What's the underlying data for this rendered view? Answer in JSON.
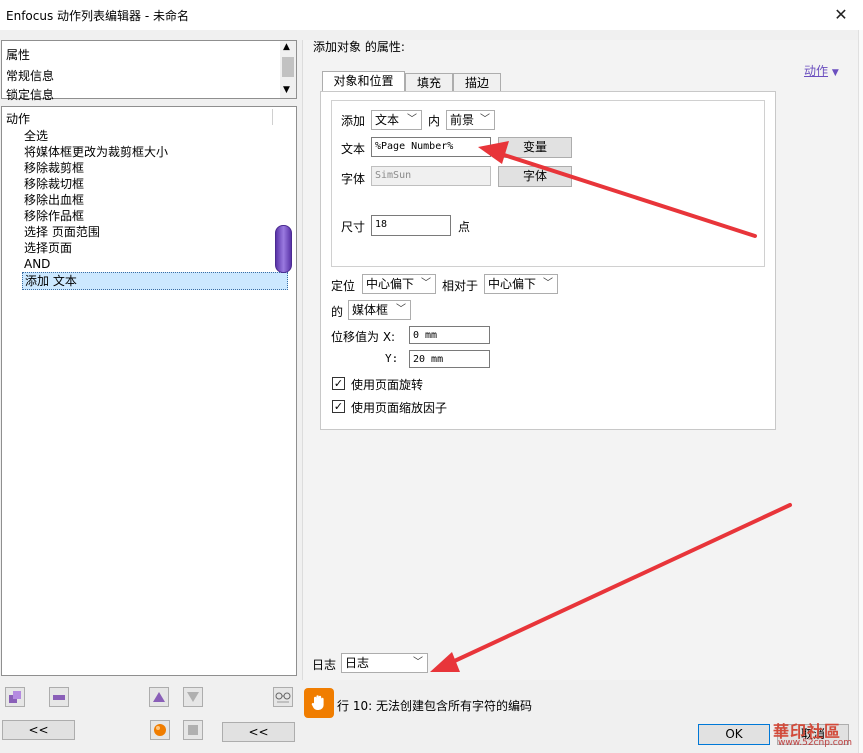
{
  "window": {
    "title": "Enfocus 动作列表编辑器 - 未命名"
  },
  "properties_list": {
    "items": [
      "属性",
      "常规信息",
      "锁定信息"
    ]
  },
  "actions_list": {
    "header": "动作",
    "items": [
      "全选",
      "将媒体框更改为裁剪框大小",
      "移除裁剪框",
      "移除裁切框",
      "移除出血框",
      "移除作品框",
      "选择 页面范围",
      "选择页面",
      "AND",
      "添加 文本"
    ],
    "selected_index": 9
  },
  "right_panel": {
    "header": "添加对象 的属性:",
    "action_link": "动作",
    "tabs": [
      "对象和位置",
      "填充",
      "描边"
    ],
    "active_tab": 0,
    "add_label": "添加",
    "add_type": "文本",
    "in_label": "内",
    "layer": "前景",
    "text_label": "文本",
    "text_value": "%Page Number%",
    "variable_button": "变量",
    "font_label": "字体",
    "font_value": "SimSun",
    "font_button": "字体",
    "size_label": "尺寸",
    "size_value": "18",
    "size_unit": "点",
    "position_label": "定位",
    "position_value": "中心偏下",
    "relative_label": "相对于",
    "relative_value": "中心偏下",
    "of_label": "的",
    "of_value": "媒体框",
    "offset_label": "位移值为 X:",
    "offset_x": "0 mm",
    "offset_y_label": "Y:",
    "offset_y": "20 mm",
    "use_page_rotation": "使用页面旋转",
    "use_page_rotation_checked": true,
    "use_page_scale": "使用页面缩放因子",
    "use_page_scale_checked": true,
    "log_label": "日志",
    "log_value": "日志"
  },
  "status": {
    "message": "行 10: 无法创建包含所有字符的编码",
    "ok_button": "OK",
    "cancel_button": "取消"
  },
  "bottom_left": {
    "collapse_left": "<<",
    "collapse_right": "<<"
  },
  "watermark": {
    "text": "華印社區",
    "url": "www.52cnp.com"
  },
  "colors": {
    "arrow": "#e8353a",
    "selection": "#cce8ff",
    "scroll_thumb_purple": "#7a52c2",
    "warning_icon": "#f07d00",
    "link": "#6b4fbf"
  }
}
